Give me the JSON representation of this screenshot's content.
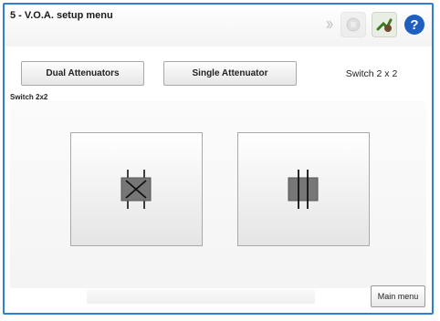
{
  "window": {
    "title": "5 - V.O.A. setup menu"
  },
  "header": {
    "icons": [
      {
        "name": "settings-shortcut-icon",
        "state": "disabled"
      },
      {
        "name": "disabled-tool-icon",
        "state": "disabled"
      },
      {
        "name": "connection-icon",
        "state": "enabled"
      },
      {
        "name": "help-icon",
        "state": "enabled"
      }
    ]
  },
  "tabs": [
    {
      "label": "Dual Attenuators",
      "active": false
    },
    {
      "label": "Single Attenuator",
      "active": false
    },
    {
      "label": "Switch 2 x 2",
      "active": true
    }
  ],
  "section": {
    "label": "Switch 2x2"
  },
  "switch_options": [
    {
      "name": "crossed-switch",
      "icon": "cross-switch-icon"
    },
    {
      "name": "straight-switch",
      "icon": "parallel-switch-icon"
    }
  ],
  "footer": {
    "main_menu_label": "Main menu"
  },
  "colors": {
    "frame_border": "#2f7fd8",
    "help_icon": "#1e5fbf",
    "switch_box": "#777777"
  }
}
